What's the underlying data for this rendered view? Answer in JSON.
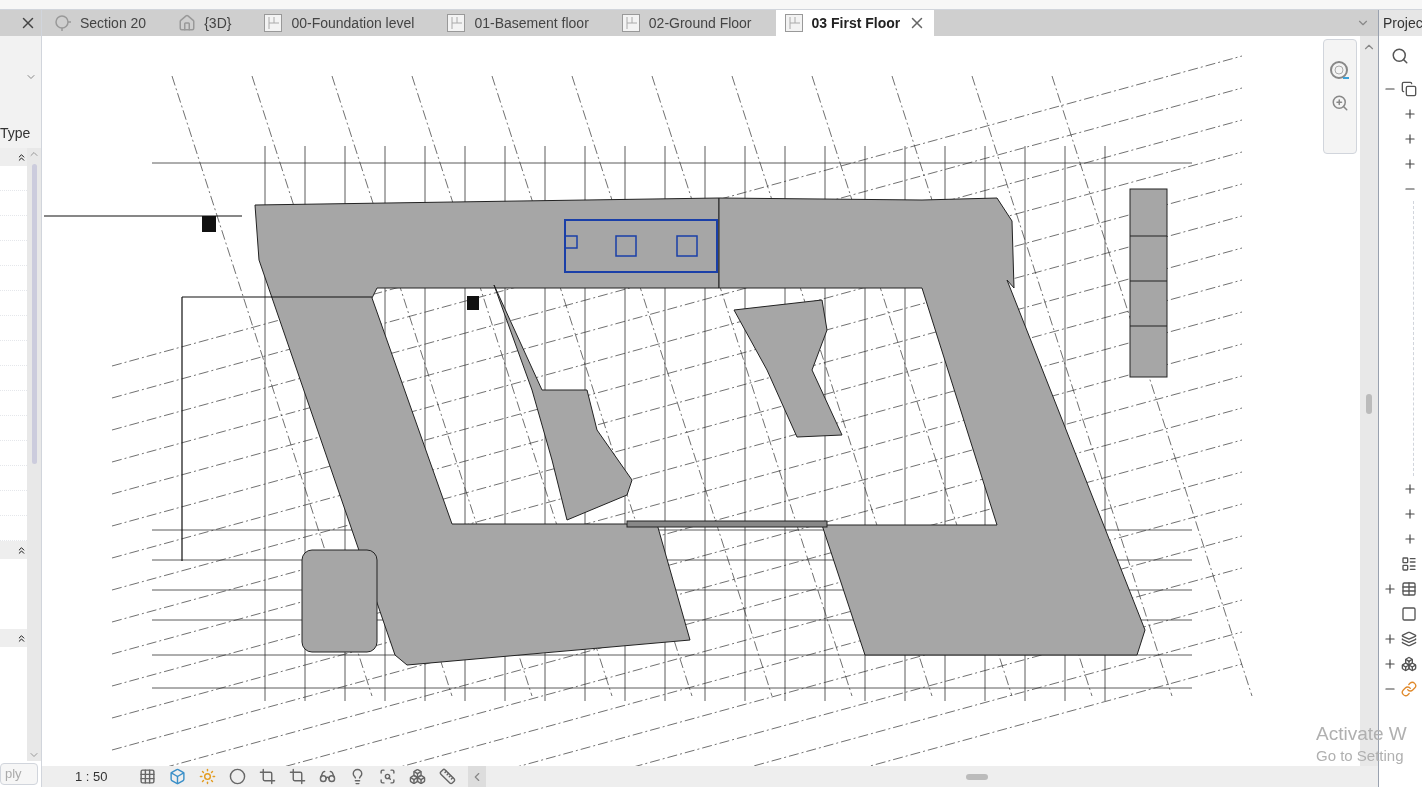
{
  "tabs": [
    {
      "label": "Section 20",
      "kind": "section",
      "selected": false
    },
    {
      "label": "{3D}",
      "kind": "model",
      "selected": false
    },
    {
      "label": "00-Foundation level",
      "kind": "plan",
      "selected": false
    },
    {
      "label": "01-Basement floor",
      "kind": "plan",
      "selected": false
    },
    {
      "label": "02-Ground Floor",
      "kind": "plan",
      "selected": false
    },
    {
      "label": "03 First Floor",
      "kind": "plan",
      "selected": true
    }
  ],
  "properties_panel": {
    "type_label": "Type",
    "apply_button": "ply"
  },
  "project_browser": {
    "title": "Projec",
    "tree": [
      {
        "expanded": true,
        "children": [
          {
            "expanded": false
          },
          {
            "expanded": false
          },
          {
            "expanded": false
          },
          {
            "expanded": true
          },
          {
            "expanded": false
          },
          {
            "expanded": false
          },
          {
            "expanded": false
          }
        ]
      },
      {
        "kind": "leaf"
      },
      {
        "kind": "branch",
        "expanded": false
      },
      {
        "kind": "leaf"
      },
      {
        "kind": "branch",
        "expanded": false
      },
      {
        "kind": "branch",
        "expanded": false
      },
      {
        "kind": "branch",
        "expanded": true
      }
    ]
  },
  "status_bar": {
    "scale": "1 : 50"
  },
  "windows_notice": {
    "title": "Activate W",
    "subtitle": "Go to Setting"
  }
}
